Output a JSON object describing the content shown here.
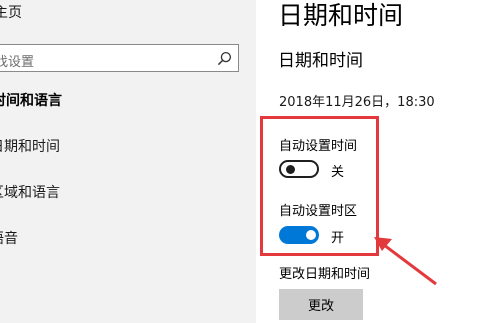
{
  "nav": {
    "home_label": "主页",
    "search_placeholder": "找设置",
    "section_label": "时间和语言",
    "items": [
      {
        "label": "日期和时间"
      },
      {
        "label": "区域和语言"
      },
      {
        "label": "语音"
      }
    ]
  },
  "main": {
    "page_title": "日期和时间",
    "section_title": "日期和时间",
    "current_datetime": "2018年11月26日，18:30",
    "auto_time": {
      "label": "自动设置时间",
      "state_label": "关",
      "enabled": false
    },
    "auto_timezone": {
      "label": "自动设置时区",
      "state_label": "开",
      "enabled": true
    },
    "change_label": "更改日期和时间",
    "change_button": "更改"
  },
  "colors": {
    "accent": "#0078d7",
    "annotation": "#e3393c",
    "nav_background": "#f2f2f2",
    "button_background": "#cccccc"
  },
  "icons": {
    "search": "search-icon"
  }
}
